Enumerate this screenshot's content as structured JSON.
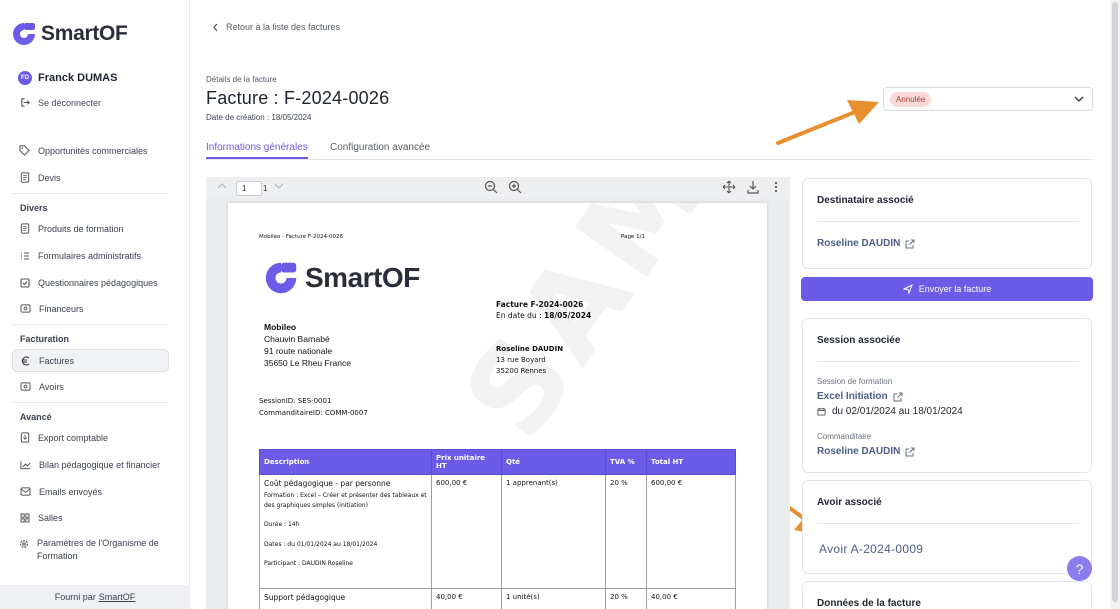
{
  "app": {
    "name": "SmartOF",
    "brand_color": "#6b5be6"
  },
  "user": {
    "initials": "FD",
    "name": "Franck DUMAS",
    "logout_label": "Se déconnecter"
  },
  "sidebar": {
    "top_items": [
      {
        "label": "Opportunités commerciales",
        "icon": "tag-icon"
      },
      {
        "label": "Devis",
        "icon": "document-icon"
      }
    ],
    "sections": [
      {
        "title": "Divers",
        "items": [
          {
            "label": "Produits de formation",
            "icon": "document-icon"
          },
          {
            "label": "Formulaires administratifs",
            "icon": "list-icon"
          },
          {
            "label": "Questionnaires pédagogiques",
            "icon": "checkbox-icon"
          },
          {
            "label": "Financeurs",
            "icon": "money-icon"
          }
        ]
      },
      {
        "title": "Facturation",
        "items": [
          {
            "label": "Factures",
            "icon": "euro-icon",
            "active": true
          },
          {
            "label": "Avoirs",
            "icon": "money-icon"
          }
        ]
      },
      {
        "title": "Avancé",
        "items": [
          {
            "label": "Export comptable",
            "icon": "export-icon"
          },
          {
            "label": "Bilan pédagogique et financier",
            "icon": "chart-icon"
          },
          {
            "label": "Emails envoyés",
            "icon": "mail-icon"
          },
          {
            "label": "Salles",
            "icon": "grid-icon"
          },
          {
            "label": "Paramètres de l'Organisme de Formation",
            "icon": "gear-icon"
          }
        ]
      }
    ],
    "footer": {
      "prefix": "Fourni par",
      "link": "SmartOF"
    }
  },
  "header": {
    "back_label": "Retour à la liste des factures",
    "subtitle": "Détails de la facture",
    "title": "Facture : F-2024-0026",
    "created": "Date de création : 18/05/2024",
    "status": {
      "label": "Annulée",
      "color": "#b23b3b"
    }
  },
  "tabs": [
    {
      "label": "Informations générales",
      "active": true
    },
    {
      "label": "Configuration avancée",
      "active": false
    }
  ],
  "pdf": {
    "page_current": "1",
    "page_total": "1",
    "header_left": "Mobileo - Facture F-2024-0026",
    "header_right": "Page 1/1",
    "logo_text": "SmartOF",
    "invoice_number": "Facture F-2024-0026",
    "invoice_date_prefix": "En date du : ",
    "invoice_date": "18/05/2024",
    "issuer": {
      "name": "Mobileo",
      "contact": "Chauvin Barnabé",
      "address1": "91 route nationale",
      "address2": "35650 Le Rheu France"
    },
    "client": {
      "name": "Roseline DAUDIN",
      "address1": "13 rue Boyard",
      "address2": "35200 Rennes"
    },
    "session_id": "SessionID: SES-0001",
    "commanditaire_id": "CommanditaireID: COMM-0007",
    "watermark": "SAMPLE",
    "table": {
      "headers": [
        "Description",
        "Prix unitaire HT",
        "Qté",
        "TVA %",
        "Total HT"
      ],
      "rows": [
        {
          "title": "Coût pédagogique - par personne",
          "detail1": "Formation : Excel – Créer et présenter des tableaux et des graphiques simples (initiation)",
          "detail2": "Durée : 14h",
          "detail3": "Dates : du 01/01/2024 au 18/01/2024",
          "detail4": "Participant : DAUDIN Roseline",
          "price": "600,00 €",
          "qty": "1 apprenant(s)",
          "tva": "20 %",
          "total": "600,00 €"
        },
        {
          "title": "Support pédagogique",
          "price": "40,00 €",
          "qty": "1 unité(s)",
          "tva": "20 %",
          "total": "40,00 €"
        }
      ]
    }
  },
  "right": {
    "recipient": {
      "title": "Destinataire associé",
      "name": "Roseline DAUDIN"
    },
    "send_button": "Envoyer la facture",
    "session": {
      "title": "Session associée",
      "session_label": "Session de formation",
      "session_name": "Excel Initiation",
      "dates": "du 02/01/2024 au 18/01/2024",
      "sponsor_label": "Commanditaire",
      "sponsor_name": "Roseline DAUDIN"
    },
    "credit": {
      "title": "Avoir associé",
      "link": "Avoir A-2024-0009"
    },
    "invoice_data": {
      "title": "Données de la facture"
    }
  },
  "annotation_color": "#e8902f"
}
